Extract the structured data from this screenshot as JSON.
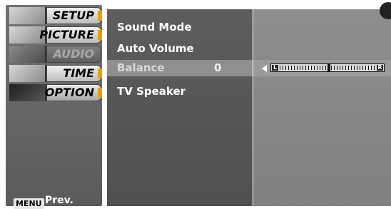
{
  "left_menu": {
    "items": [
      {
        "label": "SETUP",
        "state": "normal",
        "icon": "setup-icon"
      },
      {
        "label": "PICTURE",
        "state": "normal",
        "icon": "picture-icon"
      },
      {
        "label": "AUDIO",
        "state": "selected",
        "icon": "audio-icon"
      },
      {
        "label": "TIME",
        "state": "normal",
        "icon": "time-icon"
      },
      {
        "label": "OPTION",
        "state": "normal",
        "icon": "option-icon"
      }
    ],
    "menu_key": "MENU",
    "prev_label": "Prev."
  },
  "options": {
    "items": [
      "Sound Mode",
      "Auto Volume",
      "Balance",
      "TV Speaker"
    ],
    "selected": {
      "label": "Balance",
      "value": "0"
    }
  },
  "balance": {
    "left_label": "L",
    "right_label": "R",
    "level": 0
  },
  "colors": {
    "accent": "#e8a000"
  }
}
